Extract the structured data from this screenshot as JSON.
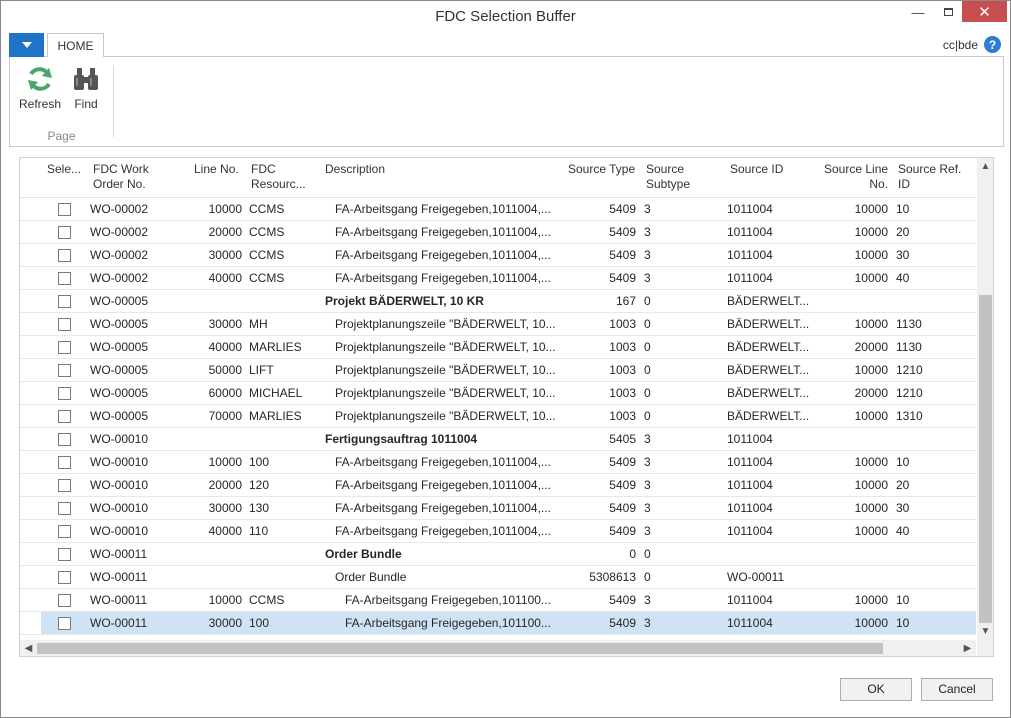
{
  "window": {
    "title": "FDC Selection Buffer"
  },
  "window_controls": {
    "minimize": "—",
    "maximize": "▫",
    "close": "✕"
  },
  "ribbon": {
    "tab": "HOME",
    "company": "cc|bde",
    "help": "?",
    "actions": [
      {
        "label": "Refresh",
        "icon": "refresh-icon"
      },
      {
        "label": "Find",
        "icon": "binoculars-icon"
      }
    ],
    "group_label": "Page"
  },
  "grid": {
    "headers": {
      "select": "Sele...",
      "work_order": "FDC Work\nOrder No.",
      "line_no": "Line No.",
      "resource": "FDC\nResourc...",
      "description": "Description",
      "source_type": "Source Type",
      "source_subtype": "Source\nSubtype",
      "source_id": "Source ID",
      "source_line": "Source Line\nNo.",
      "source_ref": "Source Ref.\nID"
    },
    "rows": [
      {
        "wo": "WO-00002",
        "line": "10000",
        "res": "CCMS",
        "desc": "FA-Arbeitsgang  Freigegeben,1011004,...",
        "stype": "5409",
        "ssub": "3",
        "sid": "1011004",
        "sline": "10000",
        "sref": "10",
        "indent": 1,
        "bold": false
      },
      {
        "wo": "WO-00002",
        "line": "20000",
        "res": "CCMS",
        "desc": "FA-Arbeitsgang  Freigegeben,1011004,...",
        "stype": "5409",
        "ssub": "3",
        "sid": "1011004",
        "sline": "10000",
        "sref": "20",
        "indent": 1,
        "bold": false
      },
      {
        "wo": "WO-00002",
        "line": "30000",
        "res": "CCMS",
        "desc": "FA-Arbeitsgang  Freigegeben,1011004,...",
        "stype": "5409",
        "ssub": "3",
        "sid": "1011004",
        "sline": "10000",
        "sref": "30",
        "indent": 1,
        "bold": false
      },
      {
        "wo": "WO-00002",
        "line": "40000",
        "res": "CCMS",
        "desc": "FA-Arbeitsgang  Freigegeben,1011004,...",
        "stype": "5409",
        "ssub": "3",
        "sid": "1011004",
        "sline": "10000",
        "sref": "40",
        "indent": 1,
        "bold": false
      },
      {
        "wo": "WO-00005",
        "line": "",
        "res": "",
        "desc": "Projekt BÄDERWELT, 10 KR",
        "stype": "167",
        "ssub": "0",
        "sid": "BÄDERWELT...",
        "sline": "",
        "sref": "",
        "indent": 0,
        "bold": true
      },
      {
        "wo": "WO-00005",
        "line": "30000",
        "res": "MH",
        "desc": "Projektplanungszeile  \"BÄDERWELT, 10...",
        "stype": "1003",
        "ssub": "0",
        "sid": "BÄDERWELT...",
        "sline": "10000",
        "sref": "1130",
        "indent": 1,
        "bold": false
      },
      {
        "wo": "WO-00005",
        "line": "40000",
        "res": "MARLIES",
        "desc": "Projektplanungszeile  \"BÄDERWELT, 10...",
        "stype": "1003",
        "ssub": "0",
        "sid": "BÄDERWELT...",
        "sline": "20000",
        "sref": "1130",
        "indent": 1,
        "bold": false
      },
      {
        "wo": "WO-00005",
        "line": "50000",
        "res": "LIFT",
        "desc": "Projektplanungszeile  \"BÄDERWELT, 10...",
        "stype": "1003",
        "ssub": "0",
        "sid": "BÄDERWELT...",
        "sline": "10000",
        "sref": "1210",
        "indent": 1,
        "bold": false
      },
      {
        "wo": "WO-00005",
        "line": "60000",
        "res": "MICHAEL",
        "desc": "Projektplanungszeile  \"BÄDERWELT, 10...",
        "stype": "1003",
        "ssub": "0",
        "sid": "BÄDERWELT...",
        "sline": "20000",
        "sref": "1210",
        "indent": 1,
        "bold": false
      },
      {
        "wo": "WO-00005",
        "line": "70000",
        "res": "MARLIES",
        "desc": "Projektplanungszeile  \"BÄDERWELT, 10...",
        "stype": "1003",
        "ssub": "0",
        "sid": "BÄDERWELT...",
        "sline": "10000",
        "sref": "1310",
        "indent": 1,
        "bold": false
      },
      {
        "wo": "WO-00010",
        "line": "",
        "res": "",
        "desc": "Fertigungsauftrag 1011004",
        "stype": "5405",
        "ssub": "3",
        "sid": "1011004",
        "sline": "",
        "sref": "",
        "indent": 0,
        "bold": true
      },
      {
        "wo": "WO-00010",
        "line": "10000",
        "res": "100",
        "desc": "FA-Arbeitsgang  Freigegeben,1011004,...",
        "stype": "5409",
        "ssub": "3",
        "sid": "1011004",
        "sline": "10000",
        "sref": "10",
        "indent": 1,
        "bold": false
      },
      {
        "wo": "WO-00010",
        "line": "20000",
        "res": "120",
        "desc": "FA-Arbeitsgang  Freigegeben,1011004,...",
        "stype": "5409",
        "ssub": "3",
        "sid": "1011004",
        "sline": "10000",
        "sref": "20",
        "indent": 1,
        "bold": false
      },
      {
        "wo": "WO-00010",
        "line": "30000",
        "res": "130",
        "desc": "FA-Arbeitsgang  Freigegeben,1011004,...",
        "stype": "5409",
        "ssub": "3",
        "sid": "1011004",
        "sline": "10000",
        "sref": "30",
        "indent": 1,
        "bold": false
      },
      {
        "wo": "WO-00010",
        "line": "40000",
        "res": "110",
        "desc": "FA-Arbeitsgang  Freigegeben,1011004,...",
        "stype": "5409",
        "ssub": "3",
        "sid": "1011004",
        "sline": "10000",
        "sref": "40",
        "indent": 1,
        "bold": false
      },
      {
        "wo": "WO-00011",
        "line": "",
        "res": "",
        "desc": "Order Bundle",
        "stype": "0",
        "ssub": "0",
        "sid": "",
        "sline": "",
        "sref": "",
        "indent": 0,
        "bold": true
      },
      {
        "wo": "WO-00011",
        "line": "",
        "res": "",
        "desc": "Order Bundle",
        "stype": "5308613",
        "ssub": "0",
        "sid": "WO-00011",
        "sline": "",
        "sref": "",
        "indent": 1,
        "bold": false
      },
      {
        "wo": "WO-00011",
        "line": "10000",
        "res": "CCMS",
        "desc": "FA-Arbeitsgang  Freigegeben,101100...",
        "stype": "5409",
        "ssub": "3",
        "sid": "1011004",
        "sline": "10000",
        "sref": "10",
        "indent": 2,
        "bold": false
      },
      {
        "wo": "WO-00011",
        "line": "30000",
        "res": "100",
        "desc": "FA-Arbeitsgang  Freigegeben,101100...",
        "stype": "5409",
        "ssub": "3",
        "sid": "1011004",
        "sline": "10000",
        "sref": "10",
        "indent": 2,
        "bold": false,
        "selected": true
      }
    ]
  },
  "footer": {
    "ok": "OK",
    "cancel": "Cancel"
  }
}
